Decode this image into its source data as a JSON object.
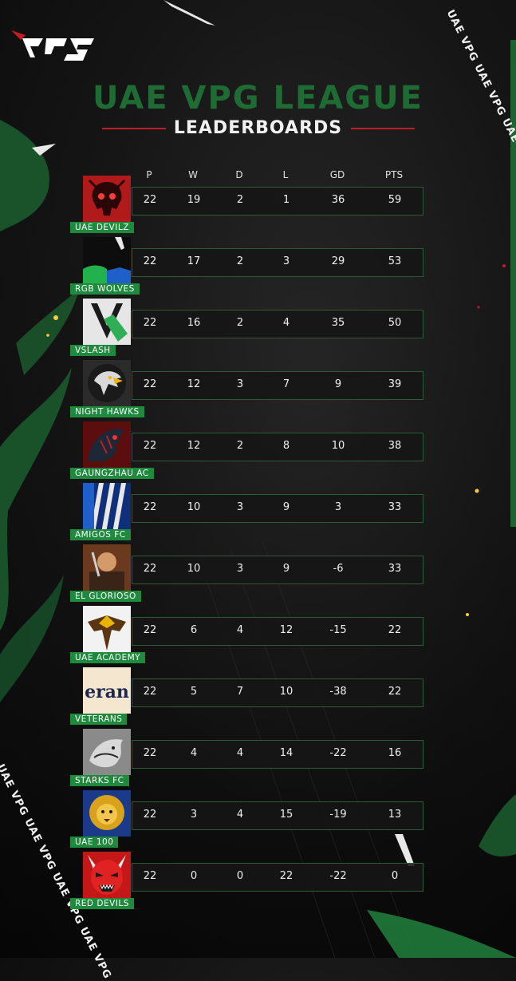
{
  "brand": {
    "logo_text": "VPG",
    "side_banner": "UAE VPG UAE VPG UAE VPG UAE VPG",
    "accent_green": "#1f6b34",
    "label_green": "#1f8a3e",
    "accent_red": "#c21d24"
  },
  "header": {
    "title": "UAE VPG LEAGUE",
    "subtitle": "LEADERBOARDS"
  },
  "columns": [
    "P",
    "W",
    "D",
    "L",
    "GD",
    "PTS"
  ],
  "teams": [
    {
      "name": "UAE DEVILZ",
      "icon": "red-skull-icon",
      "p": "22",
      "w": "19",
      "d": "2",
      "l": "1",
      "gd": "36",
      "pts": "59"
    },
    {
      "name": "RGB WOLVES",
      "icon": "wolf-icon",
      "p": "22",
      "w": "17",
      "d": "2",
      "l": "3",
      "gd": "29",
      "pts": "53"
    },
    {
      "name": "VSLASH",
      "icon": "v-slash-icon",
      "p": "22",
      "w": "16",
      "d": "2",
      "l": "4",
      "gd": "35",
      "pts": "50"
    },
    {
      "name": "NIGHT HAWKS",
      "icon": "hawk-icon",
      "p": "22",
      "w": "12",
      "d": "3",
      "l": "7",
      "gd": "9",
      "pts": "39"
    },
    {
      "name": "GAUNGZHAU AC",
      "icon": "dragon-icon",
      "p": "22",
      "w": "12",
      "d": "2",
      "l": "8",
      "gd": "10",
      "pts": "38"
    },
    {
      "name": "AMIGOS FC",
      "icon": "stripes-icon",
      "p": "22",
      "w": "10",
      "d": "3",
      "l": "9",
      "gd": "3",
      "pts": "33"
    },
    {
      "name": "EL GLORIOSO",
      "icon": "warrior-icon",
      "p": "22",
      "w": "10",
      "d": "3",
      "l": "9",
      "gd": "-6",
      "pts": "33"
    },
    {
      "name": "UAE ACADEMY",
      "icon": "eagle-icon",
      "p": "22",
      "w": "6",
      "d": "4",
      "l": "12",
      "gd": "-15",
      "pts": "22"
    },
    {
      "name": "VETERANS",
      "icon": "veterans-text-icon",
      "logo_text": "eran",
      "p": "22",
      "w": "5",
      "d": "7",
      "l": "10",
      "gd": "-38",
      "pts": "22"
    },
    {
      "name": "STARKS FC",
      "icon": "direwolf-icon",
      "p": "22",
      "w": "4",
      "d": "4",
      "l": "14",
      "gd": "-22",
      "pts": "16"
    },
    {
      "name": "UAE 100",
      "icon": "lion-icon",
      "p": "22",
      "w": "3",
      "d": "4",
      "l": "15",
      "gd": "-19",
      "pts": "13"
    },
    {
      "name": "RED DEVILS",
      "icon": "red-devil-icon",
      "p": "22",
      "w": "0",
      "d": "0",
      "l": "22",
      "gd": "-22",
      "pts": "0"
    }
  ]
}
